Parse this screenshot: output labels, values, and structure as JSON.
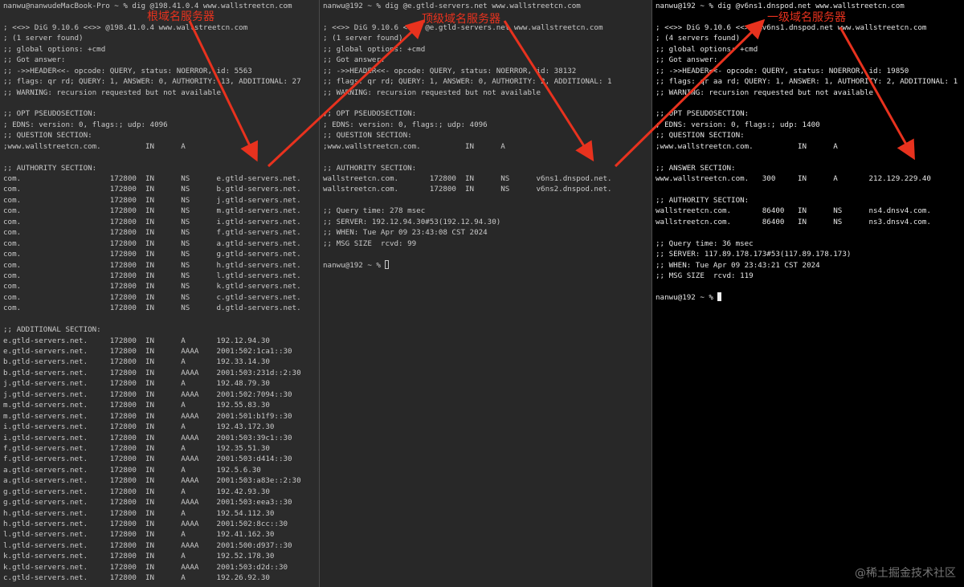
{
  "colors": {
    "annotation": "#e8321e",
    "pane_bg": "#2b2b2b",
    "pane_bg_dark": "#000000",
    "text": "#c9c9c9"
  },
  "pane1": {
    "lines": [
      "nanwu@nanwudeMacBook-Pro ~ % dig @198.41.0.4 www.wallstreetcn.com",
      "",
      "; <<>> DiG 9.10.6 <<>> @198.41.0.4 www.wallstreetcn.com",
      "; (1 server found)",
      ";; global options: +cmd",
      ";; Got answer:",
      ";; ->>HEADER<<- opcode: QUERY, status: NOERROR, id: 5563",
      ";; flags: qr rd; QUERY: 1, ANSWER: 0, AUTHORITY: 13, ADDITIONAL: 27",
      ";; WARNING: recursion requested but not available",
      "",
      ";; OPT PSEUDOSECTION:",
      "; EDNS: version: 0, flags:; udp: 4096",
      ";; QUESTION SECTION:",
      ";www.wallstreetcn.com.          IN      A",
      "",
      ";; AUTHORITY SECTION:",
      "com.                    172800  IN      NS      e.gtld-servers.net.",
      "com.                    172800  IN      NS      b.gtld-servers.net.",
      "com.                    172800  IN      NS      j.gtld-servers.net.",
      "com.                    172800  IN      NS      m.gtld-servers.net.",
      "com.                    172800  IN      NS      i.gtld-servers.net.",
      "com.                    172800  IN      NS      f.gtld-servers.net.",
      "com.                    172800  IN      NS      a.gtld-servers.net.",
      "com.                    172800  IN      NS      g.gtld-servers.net.",
      "com.                    172800  IN      NS      h.gtld-servers.net.",
      "com.                    172800  IN      NS      l.gtld-servers.net.",
      "com.                    172800  IN      NS      k.gtld-servers.net.",
      "com.                    172800  IN      NS      c.gtld-servers.net.",
      "com.                    172800  IN      NS      d.gtld-servers.net.",
      "",
      ";; ADDITIONAL SECTION:",
      "e.gtld-servers.net.     172800  IN      A       192.12.94.30",
      "e.gtld-servers.net.     172800  IN      AAAA    2001:502:1ca1::30",
      "b.gtld-servers.net.     172800  IN      A       192.33.14.30",
      "b.gtld-servers.net.     172800  IN      AAAA    2001:503:231d::2:30",
      "j.gtld-servers.net.     172800  IN      A       192.48.79.30",
      "j.gtld-servers.net.     172800  IN      AAAA    2001:502:7094::30",
      "m.gtld-servers.net.     172800  IN      A       192.55.83.30",
      "m.gtld-servers.net.     172800  IN      AAAA    2001:501:b1f9::30",
      "i.gtld-servers.net.     172800  IN      A       192.43.172.30",
      "i.gtld-servers.net.     172800  IN      AAAA    2001:503:39c1::30",
      "f.gtld-servers.net.     172800  IN      A       192.35.51.30",
      "f.gtld-servers.net.     172800  IN      AAAA    2001:503:d414::30",
      "a.gtld-servers.net.     172800  IN      A       192.5.6.30",
      "a.gtld-servers.net.     172800  IN      AAAA    2001:503:a83e::2:30",
      "g.gtld-servers.net.     172800  IN      A       192.42.93.30",
      "g.gtld-servers.net.     172800  IN      AAAA    2001:503:eea3::30",
      "h.gtld-servers.net.     172800  IN      A       192.54.112.30",
      "h.gtld-servers.net.     172800  IN      AAAA    2001:502:8cc::30",
      "l.gtld-servers.net.     172800  IN      A       192.41.162.30",
      "l.gtld-servers.net.     172800  IN      AAAA    2001:500:d937::30",
      "k.gtld-servers.net.     172800  IN      A       192.52.178.30",
      "k.gtld-servers.net.     172800  IN      AAAA    2001:503:d2d::30",
      "c.gtld-servers.net.     172800  IN      A       192.26.92.30"
    ]
  },
  "pane2": {
    "lines": [
      "nanwu@192 ~ % dig @e.gtld-servers.net www.wallstreetcn.com",
      "",
      "; <<>> DiG 9.10.6 <<>> @e.gtld-servers.net www.wallstreetcn.com",
      "; (1 server found)",
      ";; global options: +cmd",
      ";; Got answer:",
      ";; ->>HEADER<<- opcode: QUERY, status: NOERROR, id: 38132",
      ";; flags: qr rd; QUERY: 1, ANSWER: 0, AUTHORITY: 2, ADDITIONAL: 1",
      ";; WARNING: recursion requested but not available",
      "",
      ";; OPT PSEUDOSECTION:",
      "; EDNS: version: 0, flags:; udp: 4096",
      ";; QUESTION SECTION:",
      ";www.wallstreetcn.com.          IN      A",
      "",
      ";; AUTHORITY SECTION:",
      "wallstreetcn.com.       172800  IN      NS      v6ns1.dnspod.net.",
      "wallstreetcn.com.       172800  IN      NS      v6ns2.dnspod.net.",
      "",
      ";; Query time: 278 msec",
      ";; SERVER: 192.12.94.30#53(192.12.94.30)",
      ";; WHEN: Tue Apr 09 23:43:08 CST 2024",
      ";; MSG SIZE  rcvd: 99",
      ""
    ],
    "prompt": "nanwu@192 ~ % "
  },
  "pane3": {
    "lines": [
      "nanwu@192 ~ % dig @v6ns1.dnspod.net www.wallstreetcn.com",
      "",
      "; <<>> DiG 9.10.6 <<>> @v6ns1.dnspod.net www.wallstreetcn.com",
      "; (4 servers found)",
      ";; global options: +cmd",
      ";; Got answer:",
      ";; ->>HEADER<<- opcode: QUERY, status: NOERROR, id: 19850",
      ";; flags: qr aa rd; QUERY: 1, ANSWER: 1, AUTHORITY: 2, ADDITIONAL: 1",
      ";; WARNING: recursion requested but not available",
      "",
      ";; OPT PSEUDOSECTION:",
      "; EDNS: version: 0, flags:; udp: 1400",
      ";; QUESTION SECTION:",
      ";www.wallstreetcn.com.          IN      A",
      "",
      ";; ANSWER SECTION:",
      "www.wallstreetcn.com.   300     IN      A       212.129.229.40",
      "",
      ";; AUTHORITY SECTION:",
      "wallstreetcn.com.       86400   IN      NS      ns4.dnsv4.com.",
      "wallstreetcn.com.       86400   IN      NS      ns3.dnsv4.com.",
      "",
      ";; Query time: 36 msec",
      ";; SERVER: 117.89.178.173#53(117.89.178.173)",
      ";; WHEN: Tue Apr 09 23:43:21 CST 2024",
      ";; MSG SIZE  rcvd: 119",
      ""
    ],
    "prompt": "nanwu@192 ~ % "
  },
  "annotations": {
    "root": "根域名服务器",
    "tld": "顶级域名服务器",
    "second_level": "一级域名服务器"
  },
  "watermark": "@稀土掘金技术社区"
}
